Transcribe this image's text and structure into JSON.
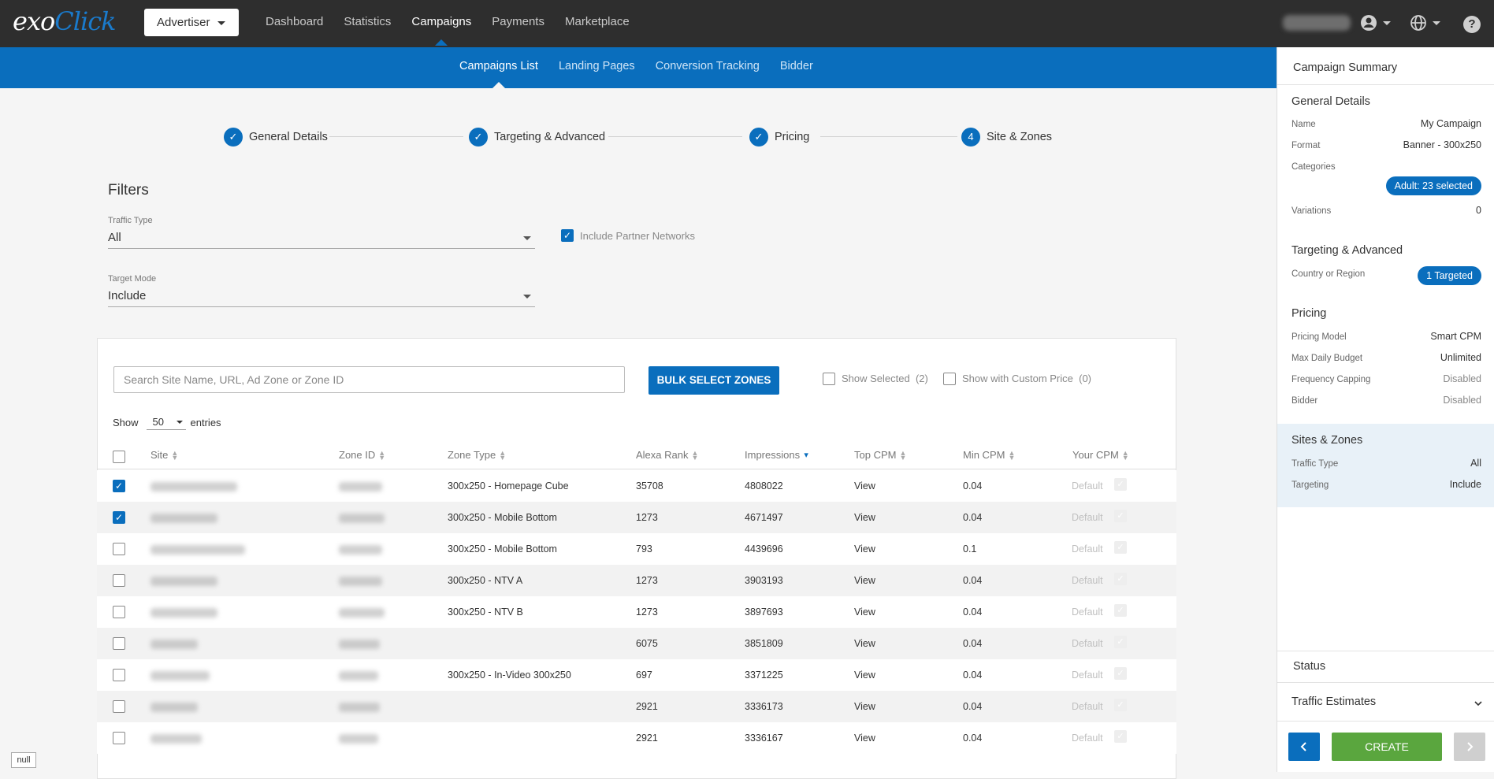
{
  "header": {
    "logo_main": "exo",
    "logo_accent": "Click",
    "account_button": "Advertiser",
    "nav": [
      "Dashboard",
      "Statistics",
      "Campaigns",
      "Payments",
      "Marketplace"
    ],
    "nav_active": "Campaigns"
  },
  "subnav": {
    "items": [
      "Campaigns List",
      "Landing Pages",
      "Conversion Tracking",
      "Bidder"
    ],
    "active": "Campaigns List"
  },
  "steps": [
    {
      "label": "General Details",
      "mark": "✓"
    },
    {
      "label": "Targeting & Advanced",
      "mark": "✓"
    },
    {
      "label": "Pricing",
      "mark": "✓"
    },
    {
      "label": "Site & Zones",
      "mark": "4"
    }
  ],
  "filters": {
    "title": "Filters",
    "traffic_type_label": "Traffic Type",
    "traffic_type_value": "All",
    "include_partner_label": "Include Partner Networks",
    "include_partner_checked": true,
    "target_mode_label": "Target Mode",
    "target_mode_value": "Include"
  },
  "table_controls": {
    "search_placeholder": "Search Site Name, URL, Ad Zone or Zone ID",
    "bulk_button": "BULK SELECT ZONES",
    "show_selected": "Show Selected",
    "show_selected_count": "(2)",
    "show_custom": "Show with Custom Price",
    "show_custom_count": "(0)",
    "show_label": "Show",
    "entries_value": "50",
    "entries_label": "entries"
  },
  "columns": [
    "Site",
    "Zone ID",
    "Zone Type",
    "Alexa Rank",
    "Impressions",
    "Top CPM",
    "Min CPM",
    "Your CPM"
  ],
  "rows": [
    {
      "checked": true,
      "zone_type": "300x250 - Homepage Cube",
      "alexa": "35708",
      "impressions": "4808022",
      "top_cpm": "View",
      "min_cpm": "0.04",
      "your_cpm": "Default"
    },
    {
      "checked": true,
      "zone_type": "300x250 - Mobile Bottom",
      "alexa": "1273",
      "impressions": "4671497",
      "top_cpm": "View",
      "min_cpm": "0.04",
      "your_cpm": "Default"
    },
    {
      "checked": false,
      "zone_type": "300x250 - Mobile Bottom",
      "alexa": "793",
      "impressions": "4439696",
      "top_cpm": "View",
      "min_cpm": "0.1",
      "your_cpm": "Default"
    },
    {
      "checked": false,
      "zone_type": "300x250 - NTV A",
      "alexa": "1273",
      "impressions": "3903193",
      "top_cpm": "View",
      "min_cpm": "0.04",
      "your_cpm": "Default"
    },
    {
      "checked": false,
      "zone_type": "300x250 - NTV B",
      "alexa": "1273",
      "impressions": "3897693",
      "top_cpm": "View",
      "min_cpm": "0.04",
      "your_cpm": "Default"
    },
    {
      "checked": false,
      "zone_type": "",
      "alexa": "6075",
      "impressions": "3851809",
      "top_cpm": "View",
      "min_cpm": "0.04",
      "your_cpm": "Default"
    },
    {
      "checked": false,
      "zone_type": "300x250 - In-Video 300x250",
      "alexa": "697",
      "impressions": "3371225",
      "top_cpm": "View",
      "min_cpm": "0.04",
      "your_cpm": "Default"
    },
    {
      "checked": false,
      "zone_type": "",
      "alexa": "2921",
      "impressions": "3336173",
      "top_cpm": "View",
      "min_cpm": "0.04",
      "your_cpm": "Default"
    },
    {
      "checked": false,
      "zone_type": "",
      "alexa": "2921",
      "impressions": "3336167",
      "top_cpm": "View",
      "min_cpm": "0.04",
      "your_cpm": "Default"
    }
  ],
  "summary": {
    "title": "Campaign Summary",
    "general": {
      "heading": "General Details",
      "name_label": "Name",
      "name_value": "My Campaign",
      "format_label": "Format",
      "format_value": "Banner - 300x250",
      "categories_label": "Categories",
      "categories_pill": "Adult: 23 selected",
      "variations_label": "Variations",
      "variations_value": "0"
    },
    "targeting": {
      "heading": "Targeting & Advanced",
      "country_label": "Country or Region",
      "country_pill": "1 Targeted"
    },
    "pricing": {
      "heading": "Pricing",
      "model_label": "Pricing Model",
      "model_value": "Smart CPM",
      "budget_label": "Max Daily Budget",
      "budget_value": "Unlimited",
      "freq_label": "Frequency Capping",
      "freq_value": "Disabled",
      "bidder_label": "Bidder",
      "bidder_value": "Disabled"
    },
    "sites": {
      "heading": "Sites & Zones",
      "traffic_label": "Traffic Type",
      "traffic_value": "All",
      "targeting_label": "Targeting",
      "targeting_value": "Include"
    },
    "status_heading": "Status",
    "traffic_estimates": "Traffic Estimates",
    "create_button": "CREATE"
  },
  "debug_label": "null",
  "colors": {
    "brand": "#0a6ebd",
    "topbar": "#2e2e2e",
    "create": "#5aa63e"
  }
}
